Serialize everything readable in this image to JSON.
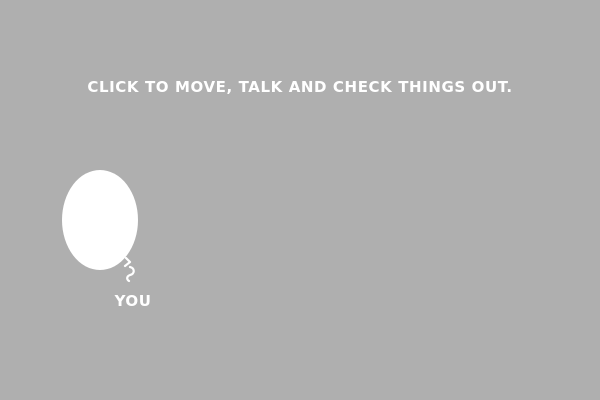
{
  "game": {
    "instruction": "CLICK TO MOVE, TALK AND CHECK THINGS OUT.",
    "player": {
      "label": "YOU",
      "pointer_icon": "curly-arrow-icon"
    },
    "colors": {
      "background": "#afafaf",
      "text": "#ffffff",
      "player": "#ffffff"
    }
  }
}
